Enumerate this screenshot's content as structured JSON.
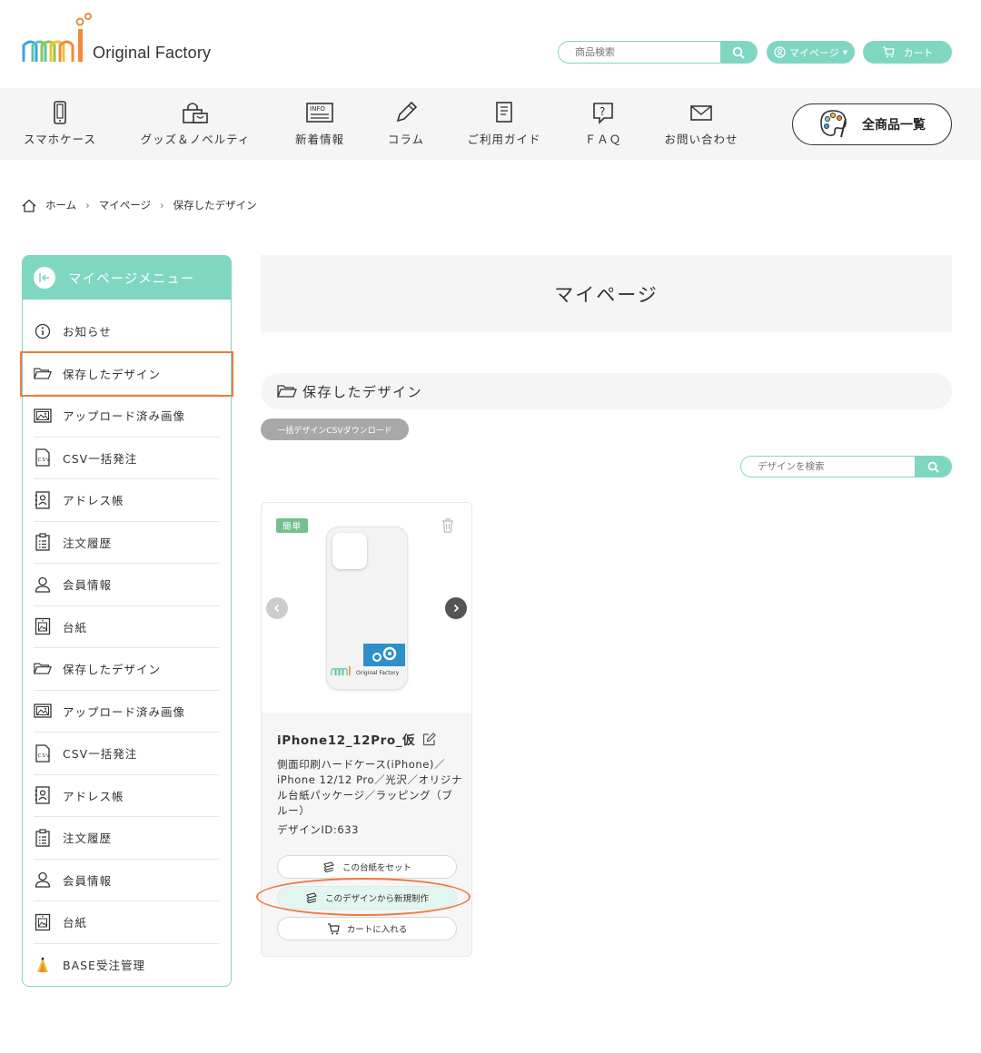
{
  "header": {
    "logo_text": "Original Factory",
    "search_placeholder": "商品検索",
    "mypage_label": "マイページ",
    "cart_label": "カート"
  },
  "nav": {
    "items": [
      {
        "label": "スマホケース",
        "icon": "smartphone-icon"
      },
      {
        "label": "グッズ＆ノベルティ",
        "icon": "shopping-bag-icon"
      },
      {
        "label": "新着情報",
        "icon": "info-icon"
      },
      {
        "label": "コラム",
        "icon": "pencil-icon"
      },
      {
        "label": "ご利用ガイド",
        "icon": "book-icon"
      },
      {
        "label": "ＦＡＱ",
        "icon": "question-icon"
      },
      {
        "label": "お問い合わせ",
        "icon": "mail-icon"
      }
    ],
    "all_products_label": "全商品一覧"
  },
  "breadcrumb": {
    "home": "ホーム",
    "mypage": "マイページ",
    "current": "保存したデザイン"
  },
  "sidebar": {
    "title": "マイページメニュー",
    "items": [
      {
        "label": "お知らせ",
        "icon": "info-circle-icon"
      },
      {
        "label": "保存したデザイン",
        "icon": "folder-icon"
      },
      {
        "label": "アップロード済み画像",
        "icon": "image-icon"
      },
      {
        "label": "CSV一括発注",
        "icon": "csv-file-icon"
      },
      {
        "label": "アドレス帳",
        "icon": "address-book-icon"
      },
      {
        "label": "注文履歴",
        "icon": "clipboard-list-icon"
      },
      {
        "label": "会員情報",
        "icon": "user-icon"
      },
      {
        "label": "台紙",
        "icon": "mount-icon"
      },
      {
        "label": "保存したデザイン",
        "icon": "folder-icon"
      },
      {
        "label": "アップロード済み画像",
        "icon": "image-icon"
      },
      {
        "label": "CSV一括発注",
        "icon": "csv-file-icon"
      },
      {
        "label": "アドレス帳",
        "icon": "address-book-icon"
      },
      {
        "label": "注文履歴",
        "icon": "clipboard-list-icon"
      },
      {
        "label": "会員情報",
        "icon": "user-icon"
      },
      {
        "label": "台紙",
        "icon": "mount-icon"
      },
      {
        "label": "BASE受注管理",
        "icon": "base-icon"
      }
    ]
  },
  "main": {
    "page_title": "マイページ",
    "section_title": "保存したデザイン",
    "csv_download_label": "一括デザインCSVダウンロード",
    "design_search_placeholder": "デザインを検索"
  },
  "card": {
    "badge": "簡単",
    "title": "iPhone12_12Pro_仮",
    "description": "側面印刷ハードケース(iPhone)／iPhone 12/12 Pro／光沢／オリジナル台紙パッケージ／ラッピング（ブルー）",
    "design_id": "デザインID:633",
    "set_mount_label": "この台紙をセット",
    "new_from_design_label": "このデザインから新規制作",
    "add_to_cart_label": "カートに入れる",
    "case_logo_text": "Original Factory"
  },
  "colors": {
    "accent": "#7fd6c1",
    "highlight": "#ef7a41",
    "badge": "#74c08f"
  }
}
